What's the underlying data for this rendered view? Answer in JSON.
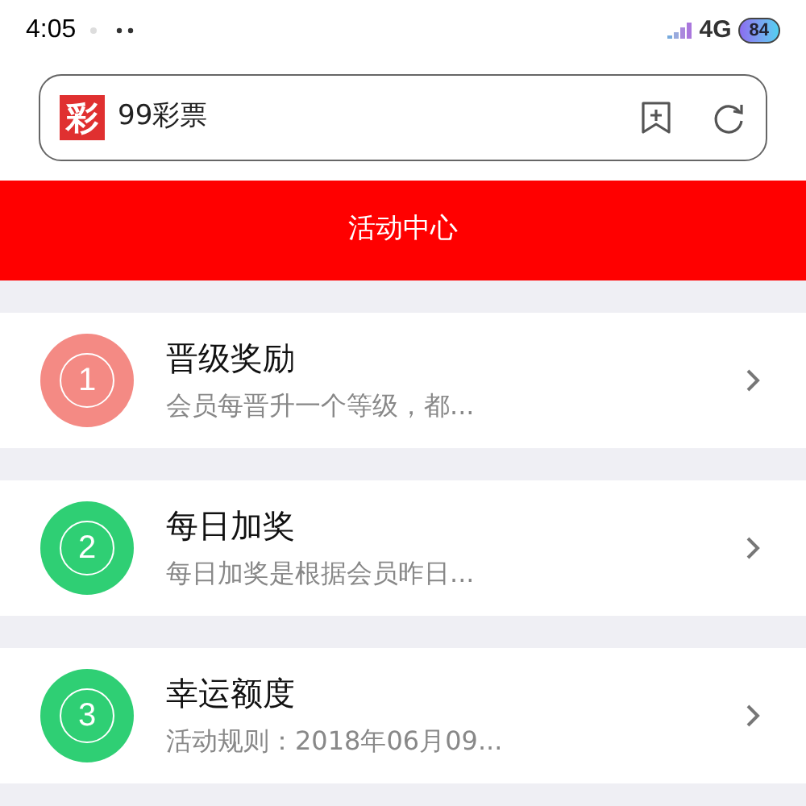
{
  "status_bar": {
    "time": "4:05",
    "network": "4G",
    "battery": "84"
  },
  "address_bar": {
    "logo": "彩",
    "title": "99彩票"
  },
  "header": {
    "title": "活动中心"
  },
  "activities": [
    {
      "number": "1",
      "title": "晋级奖励",
      "description": "会员每晋升一个等级，都...",
      "color": "#f48a84"
    },
    {
      "number": "2",
      "title": "每日加奖",
      "description": "每日加奖是根据会员昨日...",
      "color": "#2fcf74"
    },
    {
      "number": "3",
      "title": "幸运额度",
      "description": "活动规则：2018年06月09...",
      "color": "#2fcf74"
    }
  ]
}
